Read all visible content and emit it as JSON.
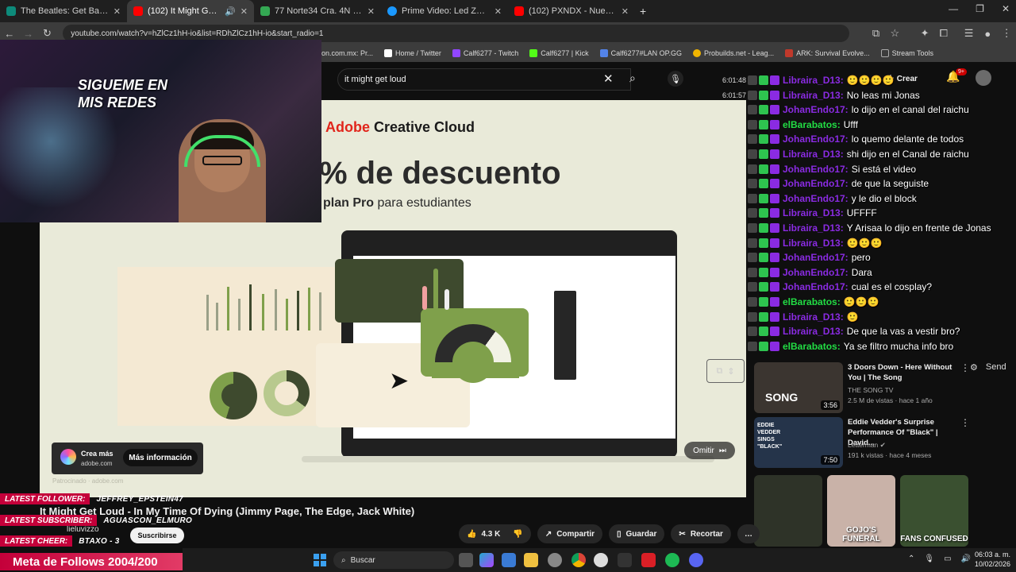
{
  "tabs": [
    {
      "title": "The Beatles: Get Back | Disney+",
      "color": "#0d8a7a"
    },
    {
      "title": "(102) It Might Get Loud - In",
      "color": "#ff0000",
      "active": true
    },
    {
      "title": "77 Norte34 Cra. 4N - Google M",
      "color": "#34a853"
    },
    {
      "title": "Prime Video: Led Zeppelin: The",
      "color": "#1a98ff"
    },
    {
      "title": "(102) PXNDX - Nuestra Aflicción",
      "color": "#ff0000"
    }
  ],
  "url": "youtube.com/watch?v=hZlCz1hH-io&list=RDhZlCz1hH-io&start_radio=1",
  "bookmarks": [
    {
      "label": "on.com.mx: Pr...",
      "color": "#888888"
    },
    {
      "label": "Home / Twitter",
      "color": "#ffffff"
    },
    {
      "label": "Calf6277 - Twitch",
      "color": "#9146ff"
    },
    {
      "label": "Calf6277 | Kick",
      "color": "#53fc18"
    },
    {
      "label": "Calf6277#LAN OP.GG",
      "color": "#5383e8"
    },
    {
      "label": "Probuilds.net - Leag...",
      "color": "#f0b400"
    },
    {
      "label": "ARK: Survival Evolve...",
      "color": "#c0392b"
    },
    {
      "label": "Stream Tools",
      "color": "#aaaaaa"
    }
  ],
  "search": {
    "value": "it might get loud"
  },
  "header": {
    "create": "Crear",
    "notifications": "9+"
  },
  "ad": {
    "brand_a": "Adobe",
    "brand_b": "Creative Cloud",
    "headline": "% de descuento",
    "sub_bold": "plan Pro",
    "sub_rest": "para estudiantes",
    "chip_title": "Crea más",
    "chip_domain": "adobe.com",
    "more_info": "Más información",
    "sponsored": "Patrocinado · adobe.com",
    "skip": "Omitir"
  },
  "webcam": {
    "line1": "SIGUEME EN",
    "line2": "MIS  REDES"
  },
  "chat": [
    {
      "ts": "6:01:48",
      "user": "Libraira_D13",
      "color": "#8a2be2",
      "msg": "🙂🙂🙂🙂"
    },
    {
      "ts": "6:01:57",
      "user": "Libraira_D13",
      "color": "#8a2be2",
      "msg": "No leas mi Jonas"
    },
    {
      "ts": "",
      "user": "JohanEndo17",
      "color": "#8a2be2",
      "msg": "lo dijo en el canal del raichu"
    },
    {
      "ts": "",
      "user": "elBarabatos",
      "color": "#22dd44",
      "msg": "Ufff"
    },
    {
      "ts": "",
      "user": "JohanEndo17",
      "color": "#8a2be2",
      "msg": "lo quemo delante de todos"
    },
    {
      "ts": "",
      "user": "Libraira_D13",
      "color": "#8a2be2",
      "msg": "shi dijo en el Canal de raichu"
    },
    {
      "ts": "",
      "user": "JohanEndo17",
      "color": "#8a2be2",
      "msg": "Si está el video"
    },
    {
      "ts": "",
      "user": "JohanEndo17",
      "color": "#8a2be2",
      "msg": "de que la seguiste"
    },
    {
      "ts": "",
      "user": "JohanEndo17",
      "color": "#8a2be2",
      "msg": "y le dio el block"
    },
    {
      "ts": "",
      "user": "Libraira_D13",
      "color": "#8a2be2",
      "msg": "UFFFF"
    },
    {
      "ts": "",
      "user": "Libraira_D13",
      "color": "#8a2be2",
      "msg": "Y Arisaa lo dijo en frente de Jonas"
    },
    {
      "ts": "",
      "user": "Libraira_D13",
      "color": "#8a2be2",
      "msg": "🙂🙂🙂"
    },
    {
      "ts": "",
      "user": "JohanEndo17",
      "color": "#8a2be2",
      "msg": "pero"
    },
    {
      "ts": "",
      "user": "JohanEndo17",
      "color": "#8a2be2",
      "msg": "Dara"
    },
    {
      "ts": "",
      "user": "JohanEndo17",
      "color": "#8a2be2",
      "msg": "cual es el cosplay?"
    },
    {
      "ts": "",
      "user": "elBarabatos",
      "color": "#22dd44",
      "msg": "🙂🙂🙂"
    },
    {
      "ts": "",
      "user": "Libraira_D13",
      "color": "#8a2be2",
      "msg": "🙂"
    },
    {
      "ts": "",
      "user": "Libraira_D13",
      "color": "#8a2be2",
      "msg": "De que la vas a vestir bro?"
    },
    {
      "ts": "",
      "user": "elBarabatos",
      "color": "#22dd44",
      "msg": "Ya se filtro mucha info bro"
    }
  ],
  "chat_ui": {
    "send": "Send"
  },
  "recs": [
    {
      "title": "3 Doors Down - Here Without You | The Song",
      "channel": "THE SONG TV",
      "meta": "2.5 M de vistas · hace 1 año",
      "duration": "3:56",
      "color": "#3b3530",
      "thumb_text": "SONG"
    },
    {
      "title": "Eddie Vedder's Surprise Performance Of \"Black\" | David...",
      "channel": "Letterman ✔",
      "meta": "191 k vistas · hace 4 meses",
      "duration": "7:50",
      "color": "#25344a",
      "thumb_text": "EDDIE VEDDER SINGS \"BLACK\""
    }
  ],
  "shorts": [
    {
      "caption": "",
      "color": "#2e3328"
    },
    {
      "caption": "GOJO'S FUNERAL",
      "color": "#c9b2a8"
    },
    {
      "caption": "FANS CONFUSED",
      "color": "#3a5030"
    }
  ],
  "video": {
    "title": "It Might Get Loud - In My Time Of Dying (Jimmy Page, The Edge, Jack White)",
    "channel": "lieluvizzo",
    "subscribe": "Suscribirse",
    "likes": "4.3 K",
    "share": "Compartir",
    "save": "Guardar",
    "clip": "Recortar"
  },
  "overlay": {
    "follower_label": "LATEST FOLLOWER:",
    "follower_value": "JEFFREY_EPSTEIN47",
    "subscriber_label": "LATEST SUBSCRIBER:",
    "subscriber_value": "AGUASCON_ELMURO",
    "cheer_label": "LATEST CHEER:",
    "cheer_value": "BTAXO - 3",
    "follows_goal": "Meta de Follows 2004/200"
  },
  "taskbar": {
    "search": "Buscar",
    "time": "06:03 a. m.",
    "date": "10/02/2026"
  }
}
